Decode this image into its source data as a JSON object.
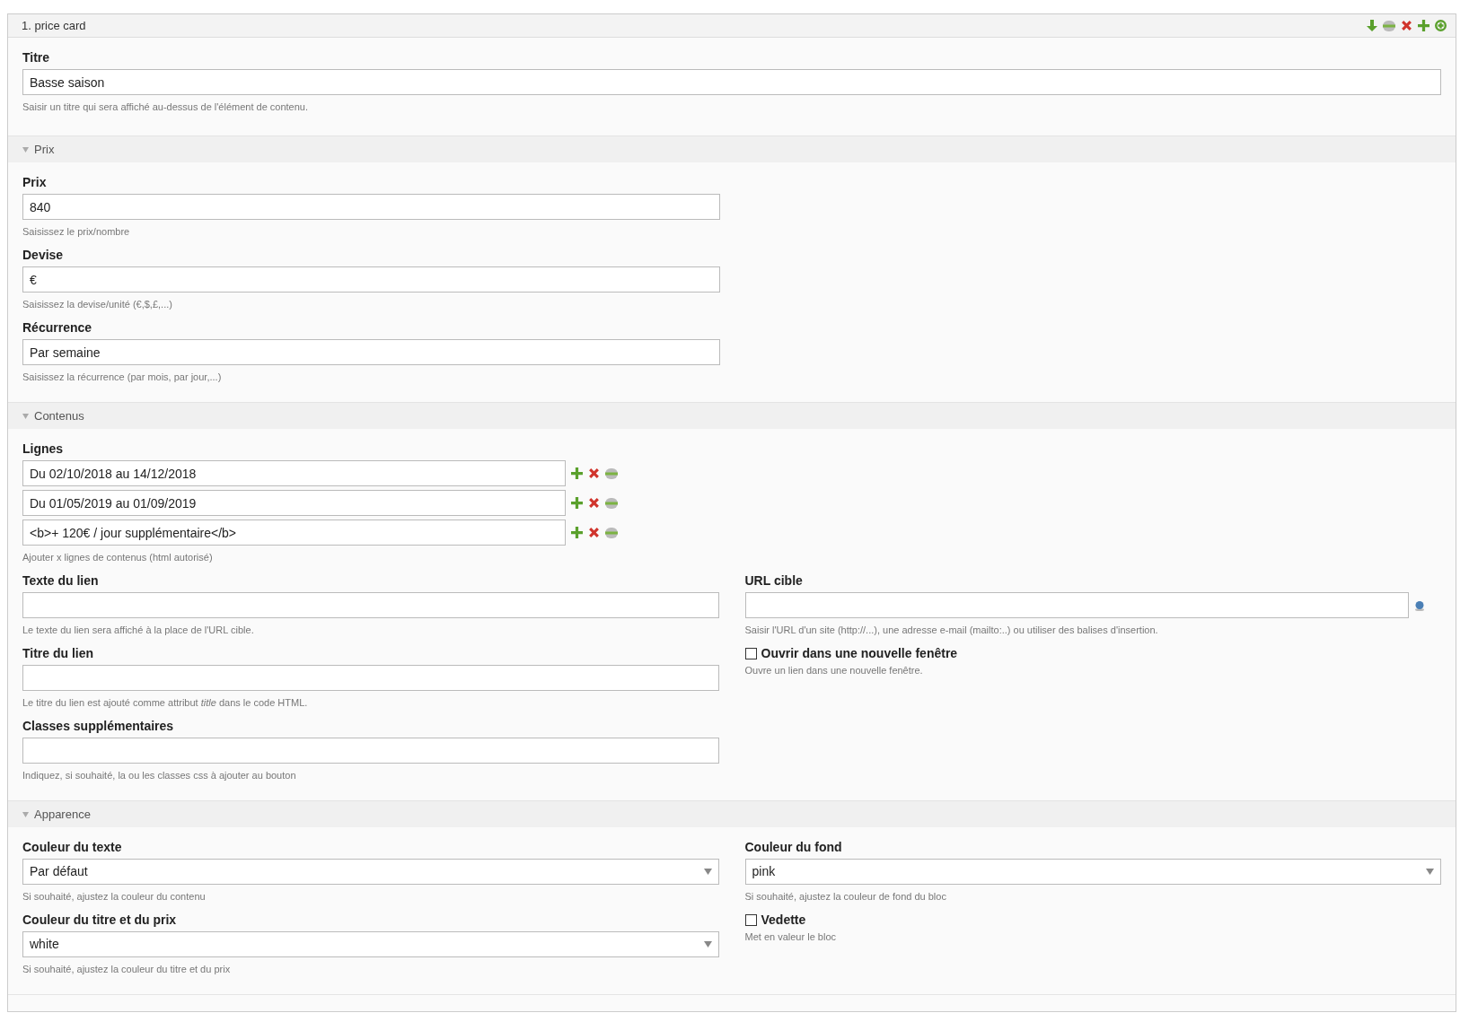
{
  "element": {
    "title": "1. price card"
  },
  "sections": [
    {
      "kind": "header",
      "fields": [
        {
          "kind": "text",
          "label": "Titre",
          "value": "Basse saison",
          "help": "Saisir un titre qui sera affiché au-dessus de l'élément de contenu."
        }
      ]
    },
    {
      "kind": "group",
      "title": "Prix",
      "expanded": true,
      "fields": [
        {
          "kind": "text",
          "label": "Prix",
          "value": "840",
          "help": "Saisissez le prix/nombre"
        },
        {
          "kind": "text",
          "label": "Devise",
          "value": "€",
          "help": "Saisissez la devise/unité (€,$,£,...)"
        },
        {
          "kind": "text",
          "label": "Récurrence",
          "value": "Par semaine",
          "help": "Saisissez la récurrence (par mois, par jour,...)"
        }
      ]
    },
    {
      "kind": "group",
      "title": "Contenus",
      "expanded": true,
      "fields": [
        {
          "kind": "lines",
          "label": "Lignes",
          "lines": [
            "Du 02/10/2018 au 14/12/2018",
            "Du 01/05/2019 au 01/09/2019",
            "<b>+ 120€ / jour supplémentaire</b>"
          ],
          "help": "Ajouter x lignes de contenus (html autorisé)"
        }
      ],
      "columns": [
        [
          {
            "kind": "text",
            "label": "Texte du lien",
            "help": "Le texte du lien sera affiché à la place de l'URL cible."
          },
          {
            "kind": "text",
            "label": "Titre du lien",
            "help": "Le titre du lien est ajouté comme attribut *title* dans le code HTML."
          },
          {
            "kind": "text",
            "label": "Classes supplémentaires",
            "help": "Indiquez, si souhaité, la ou les classes css à ajouter au bouton"
          }
        ],
        [
          {
            "kind": "link",
            "label": "URL cible",
            "help": "Saisir l'URL d'un site (http://...), une adresse e-mail (mailto:..) ou utiliser des balises d'insertion."
          },
          {
            "kind": "checkbox",
            "label": "Ouvrir dans une nouvelle fenêtre",
            "checked": false,
            "help": "Ouvre un lien dans une nouvelle fenêtre."
          }
        ]
      ]
    },
    {
      "kind": "group",
      "title": "Apparence",
      "expanded": true,
      "columns": [
        [
          {
            "kind": "select",
            "label": "Couleur du texte",
            "value": "Par défaut",
            "help": "Si souhaité, ajustez la couleur du contenu"
          },
          {
            "kind": "select",
            "label": "Couleur du titre et du prix",
            "value": "white",
            "help": "Si souhaité, ajustez la couleur du titre et du prix"
          }
        ],
        [
          {
            "kind": "select",
            "label": "Couleur du fond",
            "value": "pink",
            "help": "Si souhaité, ajustez la couleur de fond du bloc"
          },
          {
            "kind": "checkbox",
            "label": "Vedette",
            "checked": false,
            "help": "Met en valeur le bloc"
          }
        ]
      ]
    }
  ]
}
